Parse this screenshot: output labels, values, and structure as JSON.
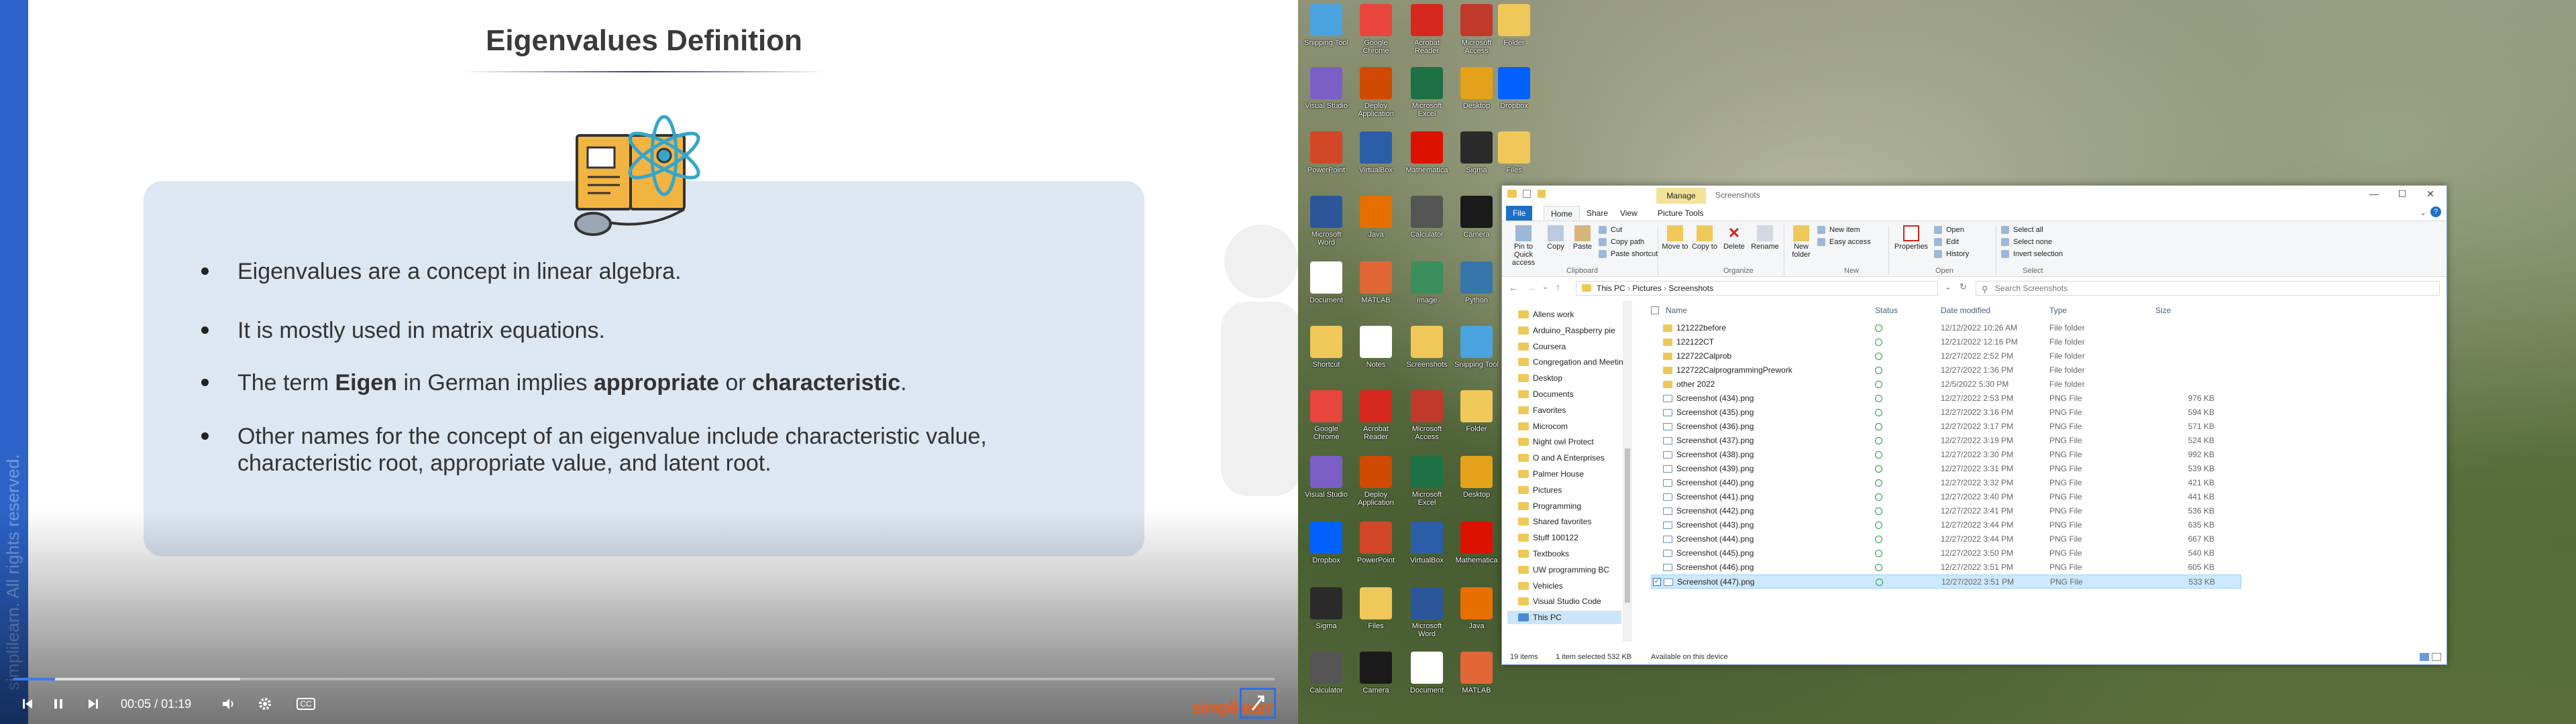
{
  "video": {
    "slide_title": "Eigenvalues Definition",
    "bullets": [
      {
        "text": "Eigenvalues are a concept in linear algebra."
      },
      {
        "text": "It is mostly used in matrix equations."
      },
      {
        "pre": "The term ",
        "b1": "Eigen",
        "mid1": " in German implies ",
        "b2": "appropriate",
        "mid2": " or ",
        "b3": "characteristic",
        "post": "."
      },
      {
        "line1": "Other names for the concept of an eigenvalue include characteristic value,",
        "line2": "characteristic root, appropriate value, and latent root."
      }
    ],
    "watermark": "simplilearn. All rights reserved.",
    "player": {
      "current_time": "00:05",
      "separator": "/",
      "duration": "01:19",
      "played_fraction": 0.033,
      "buffered_fraction": 0.18,
      "cc_label": "CC",
      "brand": "simplilearn"
    },
    "accent_color": "#2c63c8"
  },
  "desktop": {
    "icons": [
      {
        "label": "Snipping Tool",
        "color": "#4aa3df"
      },
      {
        "label": "Google Chrome",
        "color": "#e8453c"
      },
      {
        "label": "Acrobat Reader",
        "color": "#d7281e"
      },
      {
        "label": "Microsoft Access",
        "color": "#c0392b"
      },
      {
        "label": "Folder",
        "color": "#f0c85a"
      },
      {
        "label": "Visual Studio",
        "color": "#7b5fc7"
      },
      {
        "label": "Deploy Application",
        "color": "#d04a02"
      },
      {
        "label": "Microsoft Excel",
        "color": "#1e7145"
      },
      {
        "label": "Desktop",
        "color": "#e3a21a"
      },
      {
        "label": "Dropbox",
        "color": "#0061fe"
      },
      {
        "label": "PowerPoint",
        "color": "#d24726"
      },
      {
        "label": "VirtualBox",
        "color": "#2b5ea7"
      },
      {
        "label": "Mathematica",
        "color": "#dd1100"
      },
      {
        "label": "Sigma",
        "color": "#2b2b2b"
      },
      {
        "label": "Files",
        "color": "#f0c85a"
      },
      {
        "label": "Microsoft Word",
        "color": "#2b579a"
      },
      {
        "label": "Java",
        "color": "#e76f00"
      },
      {
        "label": "Calculator",
        "color": "#555555"
      },
      {
        "label": "Camera",
        "color": "#1a1a1a"
      },
      {
        "label": "Document",
        "color": "#ffffff"
      },
      {
        "label": "MATLAB",
        "color": "#e16737"
      },
      {
        "label": "Image",
        "color": "#3a8f5c"
      },
      {
        "label": "Python",
        "color": "#3776ab"
      },
      {
        "label": "Shortcut",
        "color": "#f0c85a"
      },
      {
        "label": "Notes",
        "color": "#ffffff"
      },
      {
        "label": "Screenshots",
        "color": "#f0c85a"
      }
    ]
  },
  "explorer": {
    "manage_tab": "Manage",
    "window_title": "Screenshots",
    "tabs": [
      "File",
      "Home",
      "Share",
      "View",
      "Picture Tools"
    ],
    "ribbon": {
      "pin": "Pin to Quick access",
      "copy": "Copy",
      "paste": "Paste",
      "cut": "Cut",
      "copy_path": "Copy path",
      "paste_shortcut": "Paste shortcut",
      "move_to": "Move to",
      "copy_to": "Copy to",
      "delete": "Delete",
      "rename": "Rename",
      "new_folder": "New folder",
      "new_item": "New item",
      "easy_access": "Easy access",
      "properties": "Properties",
      "open": "Open",
      "edit": "Edit",
      "history": "History",
      "select_all": "Select all",
      "select_none": "Select none",
      "invert_selection": "Invert selection",
      "group_clipboard": "Clipboard",
      "group_organize": "Organize",
      "group_new": "New",
      "group_open": "Open",
      "group_select": "Select"
    },
    "address": [
      "This PC",
      "Pictures",
      "Screenshots"
    ],
    "search_placeholder": "Search Screenshots",
    "nav": [
      "Allens work",
      "Arduino_Raspberry pie",
      "Coursera",
      "Congregation and Meetin",
      "Desktop",
      "Documents",
      "Favorites",
      "Microcom",
      "Night owl Protect",
      "O and A Enterprises",
      "Palmer House",
      "Pictures",
      "Programming",
      "Shared favorites",
      "Stuff 100122",
      "Textbooks",
      "UW programming BC",
      "Vehicles",
      "Visual Studio Code",
      "This PC"
    ],
    "columns": [
      "Name",
      "Status",
      "Date modified",
      "Type",
      "Size"
    ],
    "files": [
      {
        "name": "121222before",
        "date": "12/12/2022 10:26 AM",
        "type": "File folder",
        "size": "",
        "kind": "folder"
      },
      {
        "name": "122122CT",
        "date": "12/21/2022 12:16 PM",
        "type": "File folder",
        "size": "",
        "kind": "folder"
      },
      {
        "name": "122722Calprob",
        "date": "12/27/2022 2:52 PM",
        "type": "File folder",
        "size": "",
        "kind": "folder"
      },
      {
        "name": "122722CalprogrammingPrework",
        "date": "12/27/2022 1:36 PM",
        "type": "File folder",
        "size": "",
        "kind": "folder"
      },
      {
        "name": "other 2022",
        "date": "12/5/2022 5:30 PM",
        "type": "File folder",
        "size": "",
        "kind": "folder"
      },
      {
        "name": "Screenshot (434).png",
        "date": "12/27/2022 2:53 PM",
        "type": "PNG File",
        "size": "976 KB",
        "kind": "png"
      },
      {
        "name": "Screenshot (435).png",
        "date": "12/27/2022 3:16 PM",
        "type": "PNG File",
        "size": "594 KB",
        "kind": "png"
      },
      {
        "name": "Screenshot (436).png",
        "date": "12/27/2022 3:17 PM",
        "type": "PNG File",
        "size": "571 KB",
        "kind": "png"
      },
      {
        "name": "Screenshot (437).png",
        "date": "12/27/2022 3:19 PM",
        "type": "PNG File",
        "size": "524 KB",
        "kind": "png"
      },
      {
        "name": "Screenshot (438).png",
        "date": "12/27/2022 3:30 PM",
        "type": "PNG File",
        "size": "992 KB",
        "kind": "png"
      },
      {
        "name": "Screenshot (439).png",
        "date": "12/27/2022 3:31 PM",
        "type": "PNG File",
        "size": "539 KB",
        "kind": "png"
      },
      {
        "name": "Screenshot (440).png",
        "date": "12/27/2022 3:32 PM",
        "type": "PNG File",
        "size": "421 KB",
        "kind": "png"
      },
      {
        "name": "Screenshot (441).png",
        "date": "12/27/2022 3:40 PM",
        "type": "PNG File",
        "size": "441 KB",
        "kind": "png"
      },
      {
        "name": "Screenshot (442).png",
        "date": "12/27/2022 3:41 PM",
        "type": "PNG File",
        "size": "536 KB",
        "kind": "png"
      },
      {
        "name": "Screenshot (443).png",
        "date": "12/27/2022 3:44 PM",
        "type": "PNG File",
        "size": "635 KB",
        "kind": "png"
      },
      {
        "name": "Screenshot (444).png",
        "date": "12/27/2022 3:44 PM",
        "type": "PNG File",
        "size": "667 KB",
        "kind": "png"
      },
      {
        "name": "Screenshot (445).png",
        "date": "12/27/2022 3:50 PM",
        "type": "PNG File",
        "size": "540 KB",
        "kind": "png"
      },
      {
        "name": "Screenshot (446).png",
        "date": "12/27/2022 3:51 PM",
        "type": "PNG File",
        "size": "605 KB",
        "kind": "png"
      },
      {
        "name": "Screenshot (447).png",
        "date": "12/27/2022 3:51 PM",
        "type": "PNG File",
        "size": "533 KB",
        "kind": "png",
        "selected": true
      }
    ],
    "status": {
      "items": "19 items",
      "selected": "1 item selected  532 KB",
      "availability": "Available on this device"
    }
  }
}
